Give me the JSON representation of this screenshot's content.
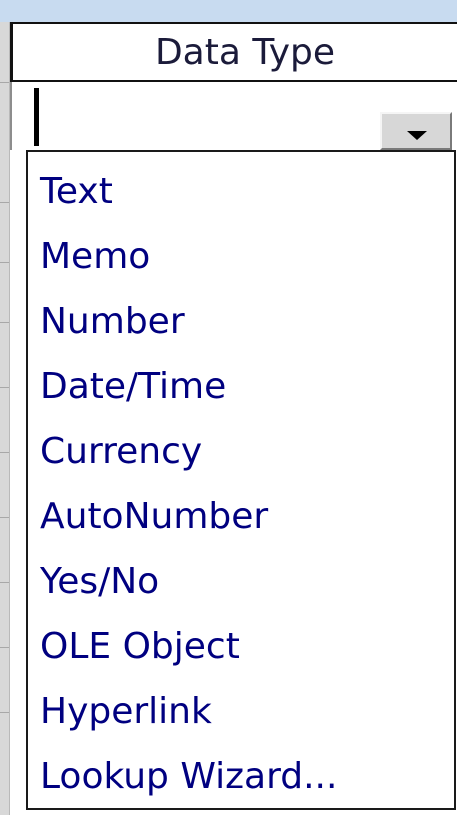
{
  "column": {
    "header": "Data Type",
    "current_value": ""
  },
  "dropdown": {
    "icon": "chevron-down-icon",
    "options": [
      "Text",
      "Memo",
      "Number",
      "Date/Time",
      "Currency",
      "AutoNumber",
      "Yes/No",
      "OLE Object",
      "Hyperlink",
      "Lookup Wizard..."
    ]
  },
  "colors": {
    "option_text": "#000080",
    "header_text": "#1b1b3a",
    "top_strip": "#c8dbf0",
    "border": "#1a1a1a"
  }
}
